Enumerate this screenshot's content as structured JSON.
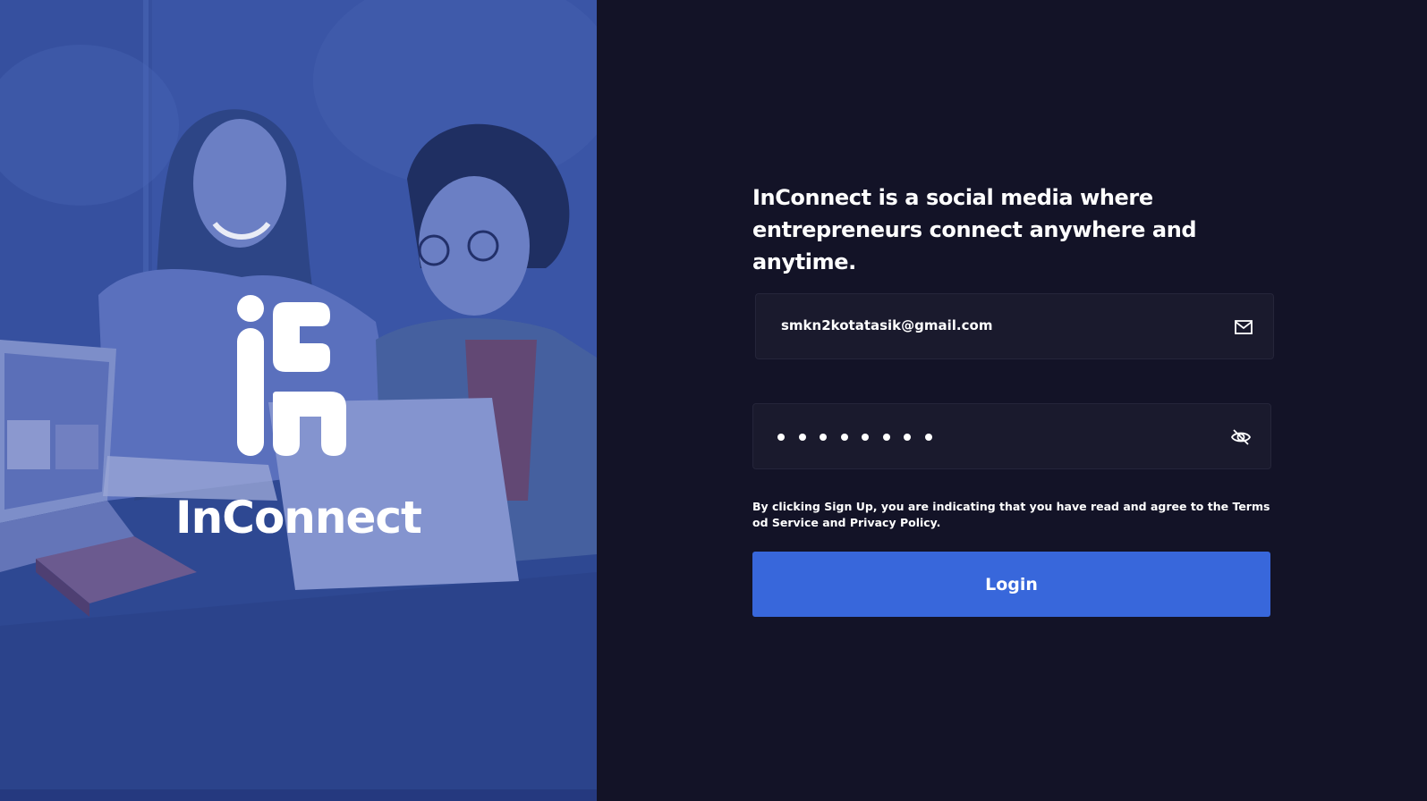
{
  "brand": {
    "name": "InConnect",
    "logo_icon": "inconnect-logo-icon"
  },
  "hero": {
    "photo": "two-people-laughing-at-laptops-photo",
    "overlay_color": "#3a55a6"
  },
  "login": {
    "tagline": "InConnect is a social media where entrepreneurs connect anywhere and anytime.",
    "email": {
      "value": "smkn2kotatasik@gmail.com",
      "icon": "envelope-icon"
    },
    "password": {
      "masked_length": 8,
      "toggle_icon": "eye-off-icon"
    },
    "terms_text": "By clicking Sign Up, you are indicating that you have read and agree to the Terms od Service and Privacy Policy.",
    "submit_label": "Login"
  },
  "colors": {
    "background": "#131327",
    "field_background": "#1a1a2d",
    "accent": "#3867db",
    "text": "#ffffff"
  }
}
